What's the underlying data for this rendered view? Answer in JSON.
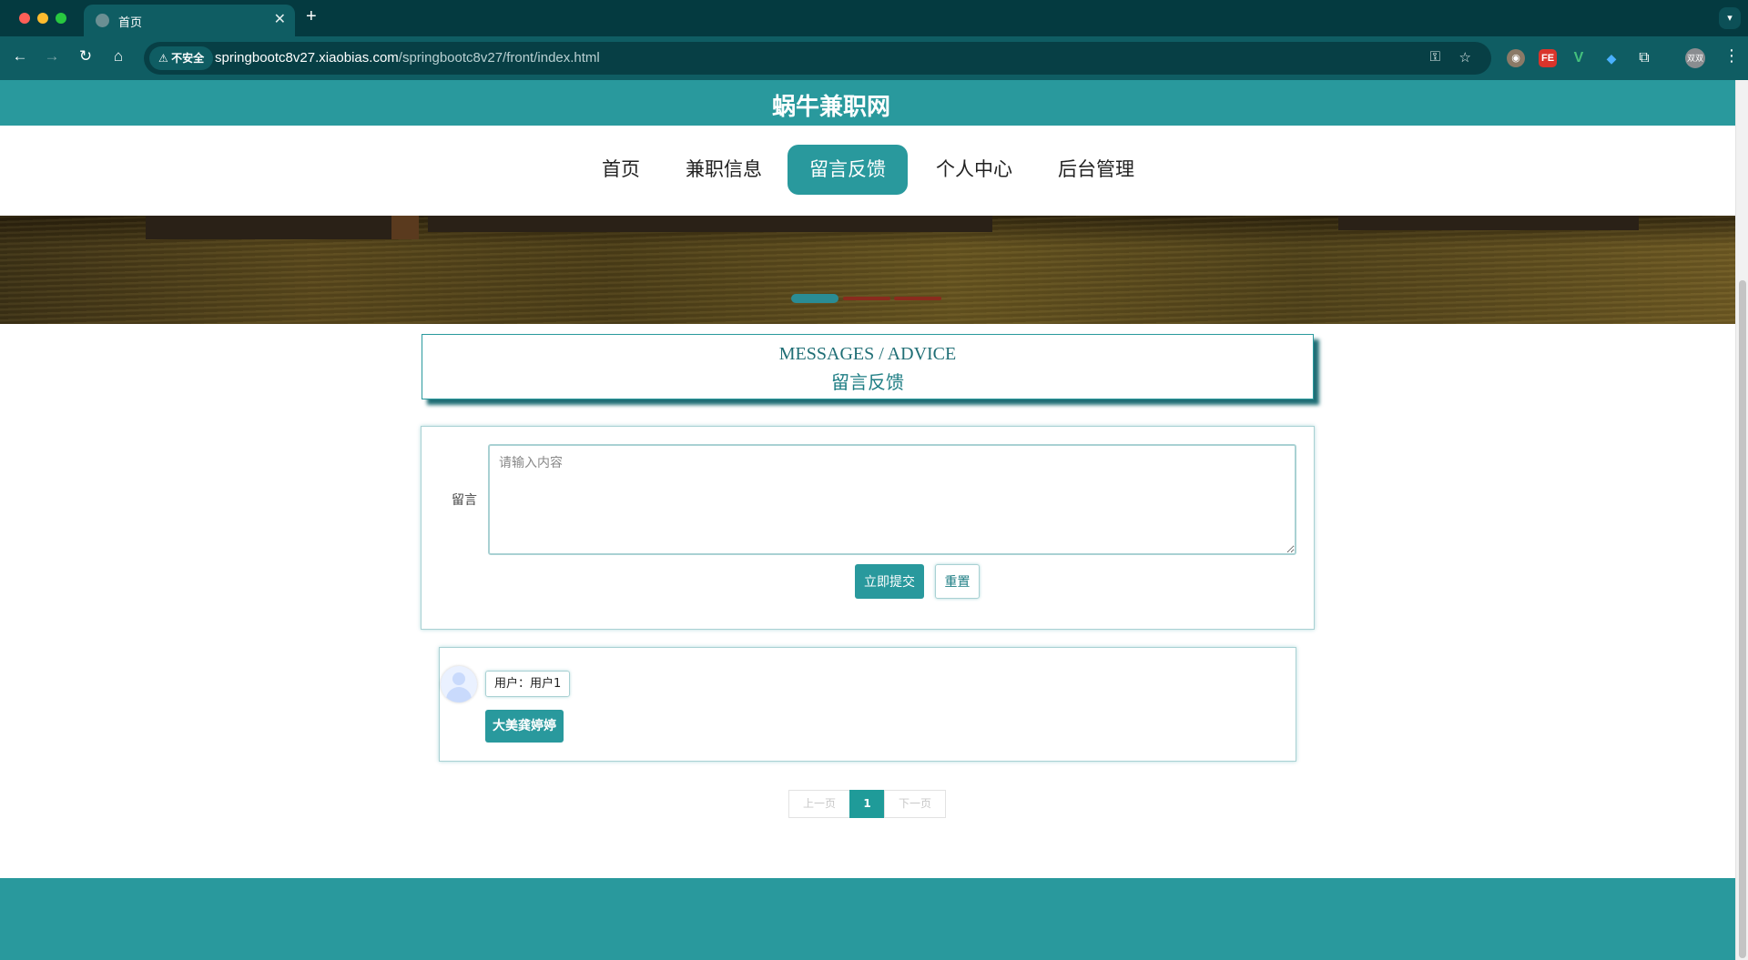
{
  "browser": {
    "tab_title": "首页",
    "tab_close": "✕",
    "new_tab": "+",
    "security_label": "不安全",
    "url_host": "springbootc8v27.xiaobias.com",
    "url_path": "/springbootc8v27/front/index.html",
    "profile_label": "双双",
    "icons": [
      "back-icon",
      "forward-icon",
      "reload-icon",
      "home-icon",
      "key-icon",
      "star-icon",
      "extensions-icon",
      "menu-icon"
    ]
  },
  "site": {
    "title": "蜗牛兼职网"
  },
  "nav": {
    "items": [
      {
        "label": "首页",
        "active": false
      },
      {
        "label": "兼职信息",
        "active": false
      },
      {
        "label": "留言反馈",
        "active": true
      },
      {
        "label": "个人中心",
        "active": false
      },
      {
        "label": "后台管理",
        "active": false
      }
    ]
  },
  "banner": {
    "slides_total": 3,
    "active_slide": 1
  },
  "section": {
    "title_en": "MESSAGES / ADVICE",
    "title_cn": "留言反馈"
  },
  "form": {
    "label": "留言",
    "placeholder": "请输入内容",
    "value": "",
    "submit_label": "立即提交",
    "reset_label": "重置"
  },
  "messages": [
    {
      "user": "用户：用户1",
      "content": "大美龚婷婷"
    }
  ],
  "pagination": {
    "prev_label": "上一页",
    "current_page": "1",
    "next_label": "下一页"
  },
  "colors": {
    "primary": "#29999d",
    "primary_dark": "#1f6e75",
    "browser_dark": "#043a40",
    "browser_toolbar": "#0f5d63"
  }
}
